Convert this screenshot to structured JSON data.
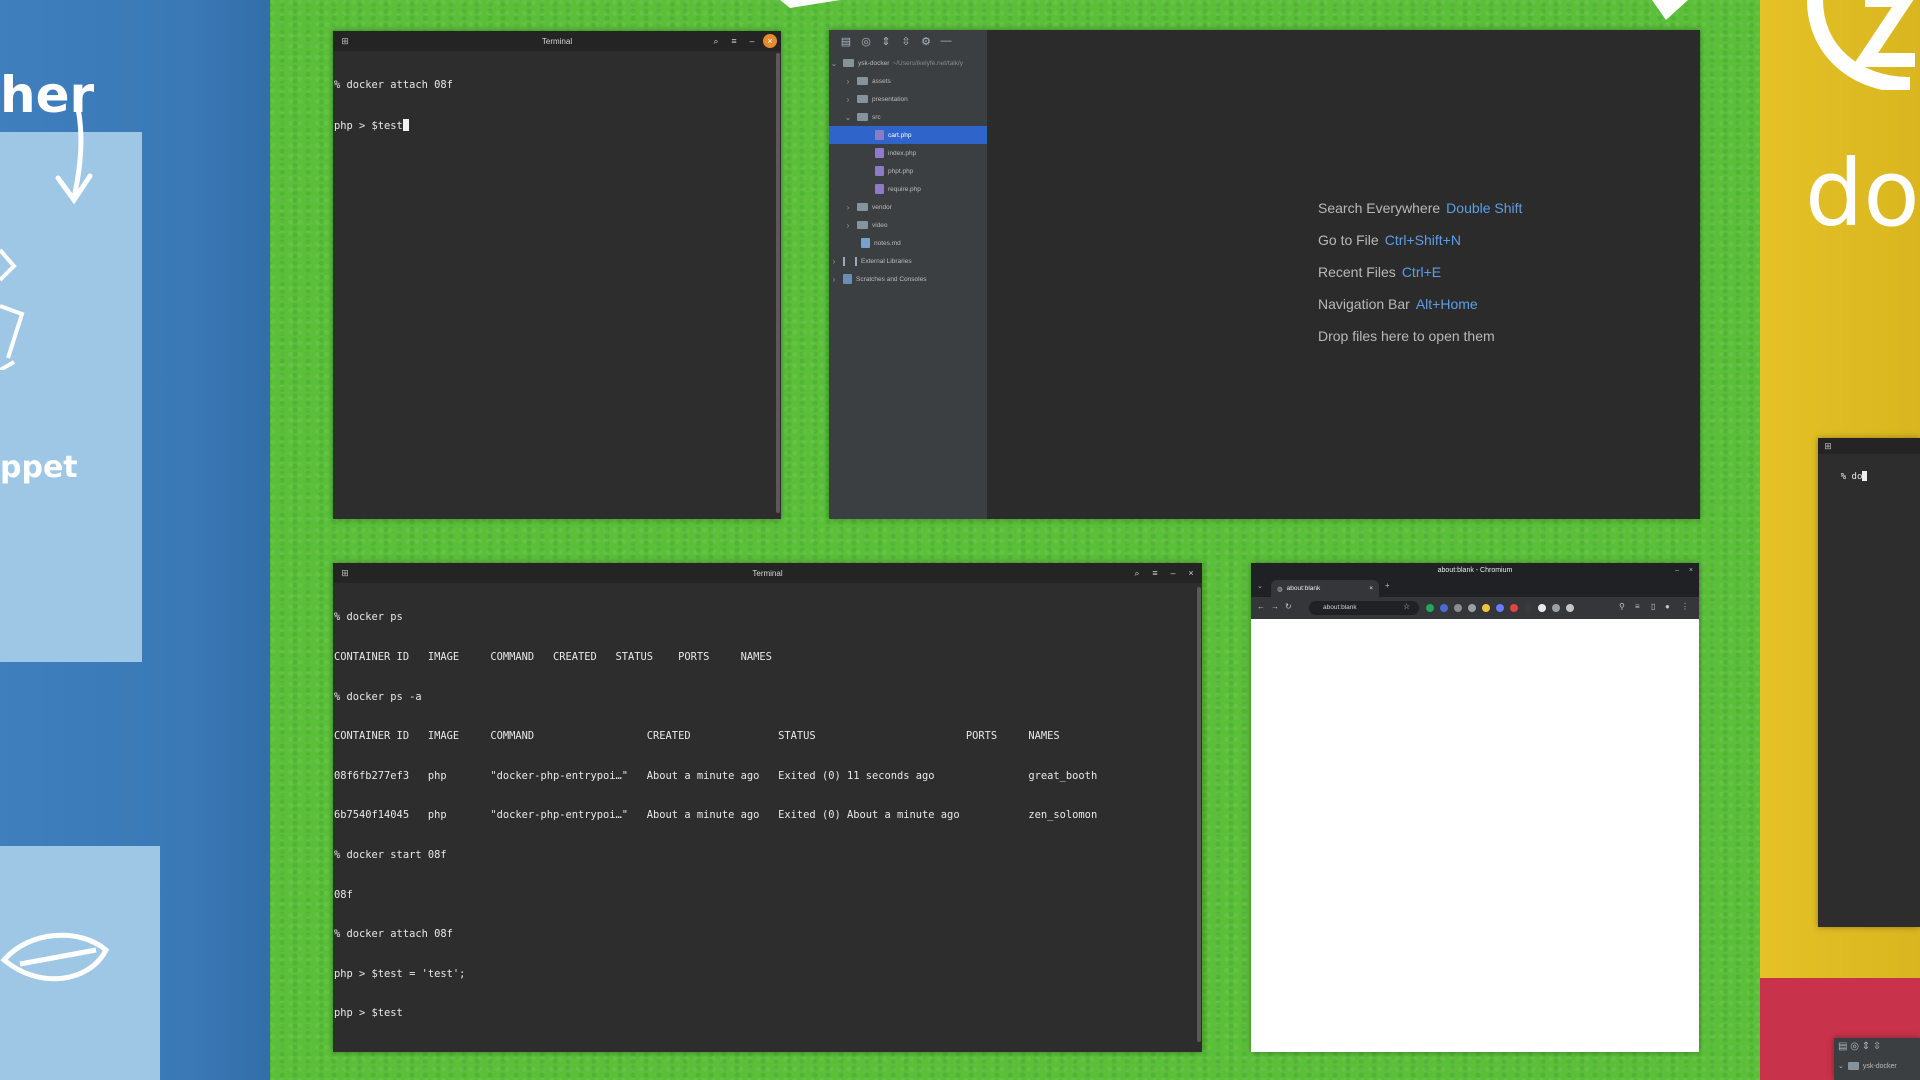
{
  "wallpaper": {
    "left_text": "her",
    "left_text2": "ppet",
    "right_text": "do",
    "colors": {
      "green": "#5bbf3a",
      "blue": "#3f7fbd",
      "yellow": "#e5c227",
      "red": "#c8324a"
    }
  },
  "terminal_small": {
    "title": "Terminal",
    "lines": [
      "% docker attach 08f",
      "php > $test"
    ]
  },
  "ide": {
    "project": "ysk-docker",
    "project_path": "~/Users/ikelyfe.net/talk/y",
    "tree": [
      {
        "label": "assets",
        "type": "folder",
        "expanded": false
      },
      {
        "label": "presentation",
        "type": "folder",
        "expanded": false
      },
      {
        "label": "src",
        "type": "folder",
        "expanded": true
      },
      {
        "label": "cart.php",
        "type": "file",
        "selected": true
      },
      {
        "label": "index.php",
        "type": "file"
      },
      {
        "label": "phpt.php",
        "type": "file"
      },
      {
        "label": "require.php",
        "type": "file"
      },
      {
        "label": "vendor",
        "type": "folder",
        "expanded": false
      },
      {
        "label": "video",
        "type": "folder",
        "expanded": false
      },
      {
        "label": "notes.md",
        "type": "file"
      },
      {
        "label": "External Libraries",
        "type": "lib"
      },
      {
        "label": "Scratches and Consoles",
        "type": "scratch"
      }
    ],
    "hints": [
      {
        "label": "Search Everywhere",
        "key": "Double Shift"
      },
      {
        "label": "Go to File",
        "key": "Ctrl+Shift+N"
      },
      {
        "label": "Recent Files",
        "key": "Ctrl+E"
      },
      {
        "label": "Navigation Bar",
        "key": "Alt+Home"
      },
      {
        "label": "Drop files here to open them",
        "key": ""
      }
    ],
    "accent": "#5c9ee8"
  },
  "terminal_large": {
    "title": "Terminal",
    "lines": [
      "% docker ps",
      "CONTAINER ID   IMAGE     COMMAND   CREATED   STATUS    PORTS     NAMES",
      "% docker ps -a",
      "CONTAINER ID   IMAGE     COMMAND                  CREATED              STATUS                        PORTS     NAMES",
      "08f6fb277ef3   php       \"docker-php-entrypoi…\"   About a minute ago   Exited (0) 11 seconds ago               great_booth",
      "6b7540f14045   php       \"docker-php-entrypoi…\"   About a minute ago   Exited (0) About a minute ago           zen_solomon",
      "% docker start 08f",
      "08f",
      "% docker attach 08f",
      "php > $test = 'test';",
      "php > $test"
    ]
  },
  "chromium": {
    "title": "about:blank - Chromium",
    "tab_label": "about:blank",
    "address": "about:blank"
  },
  "terminal_partial": {
    "line": "% do"
  },
  "ide_partial": {
    "project": "ysk-docker"
  }
}
